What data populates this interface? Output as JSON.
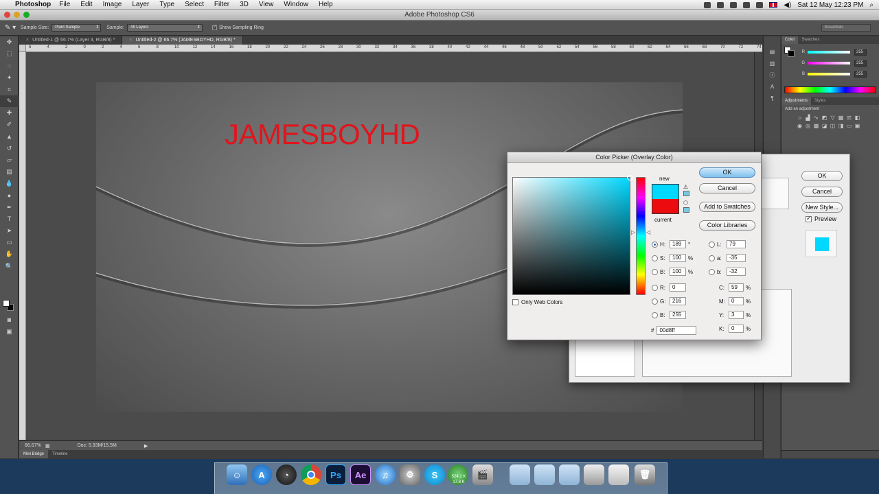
{
  "menubar": {
    "app_name": "Photoshop",
    "menus": [
      "File",
      "Edit",
      "Image",
      "Layer",
      "Type",
      "Select",
      "Filter",
      "3D",
      "View",
      "Window",
      "Help"
    ],
    "clock": "Sat 12 May  12:23 PM"
  },
  "window": {
    "title": "Adobe Photoshop CS6"
  },
  "options": {
    "sample_size_label": "Sample Size:",
    "sample_size_value": "Point Sample",
    "sample_label": "Sample:",
    "sample_value": "All Layers",
    "sampling_ring_label": "Show Sampling Ring",
    "workspace": "Essentials"
  },
  "doc_tabs": [
    {
      "label": "Untitled-1 @ 66.7% (Layer 3, RGB/8) *"
    },
    {
      "label": "Untitled-2 @ 66.7% (JAMESBOYHD, RGB/8) *"
    }
  ],
  "ruler_ticks": [
    "6",
    "4",
    "2",
    "0",
    "2",
    "4",
    "6",
    "8",
    "10",
    "12",
    "14",
    "16",
    "18",
    "20",
    "22",
    "24",
    "26",
    "28",
    "30",
    "32",
    "34",
    "36",
    "38",
    "40",
    "42",
    "44",
    "46",
    "48",
    "50",
    "52",
    "54",
    "56",
    "58",
    "60",
    "62",
    "64",
    "66",
    "68",
    "70",
    "72",
    "74"
  ],
  "canvas": {
    "text": "JAMESBOYHD",
    "text_color": "#e0151d"
  },
  "status": {
    "zoom": "66.67%",
    "doc_size": "Doc: 5.93M/15.5M"
  },
  "bottom_tabs": [
    "Mini Bridge",
    "Timeline"
  ],
  "color_panel": {
    "tabs": [
      "Color",
      "Swatches"
    ],
    "rows": [
      {
        "label": "R",
        "value": "255"
      },
      {
        "label": "G",
        "value": "255"
      },
      {
        "label": "B",
        "value": "255"
      }
    ]
  },
  "adjust_panel": {
    "tabs": [
      "Adjustments",
      "Styles"
    ],
    "header": "Add an adjustment"
  },
  "layer_style": {
    "ok": "OK",
    "cancel": "Cancel",
    "new_style": "New Style...",
    "preview": "Preview"
  },
  "picker": {
    "title": "Color Picker (Overlay Color)",
    "new_label": "new",
    "current_label": "current",
    "new_color": "#00d8ff",
    "current_color": "#ec0b0e",
    "buttons": {
      "ok": "OK",
      "cancel": "Cancel",
      "add_swatches": "Add to Swatches",
      "libraries": "Color Libraries"
    },
    "only_web": "Only Web Colors",
    "hsb": [
      {
        "label": "H:",
        "value": "189",
        "unit": "°"
      },
      {
        "label": "S:",
        "value": "100",
        "unit": "%"
      },
      {
        "label": "B:",
        "value": "100",
        "unit": "%"
      }
    ],
    "rgb": [
      {
        "label": "R:",
        "value": "0"
      },
      {
        "label": "G:",
        "value": "216"
      },
      {
        "label": "B:",
        "value": "255"
      }
    ],
    "lab": [
      {
        "label": "L:",
        "value": "79"
      },
      {
        "label": "a:",
        "value": "-35"
      },
      {
        "label": "b:",
        "value": "-32"
      }
    ],
    "cmyk": [
      {
        "label": "C:",
        "value": "59",
        "unit": "%"
      },
      {
        "label": "M:",
        "value": "0",
        "unit": "%"
      },
      {
        "label": "Y:",
        "value": "3",
        "unit": "%"
      },
      {
        "label": "K:",
        "value": "0",
        "unit": "%"
      }
    ],
    "hex_label": "#",
    "hex": "00d8ff"
  },
  "dock": {
    "apps": [
      "finder-icon",
      "app-store-icon",
      "dashboard-icon",
      "chrome-icon",
      "photoshop-icon",
      "after-effects-icon",
      "itunes-icon",
      "system-preferences-icon",
      "skype-icon",
      "network-meter-icon",
      "photo-booth-icon",
      "applications-folder-icon",
      "documents-folder-icon",
      "folder-icon",
      "stack-icon",
      "downloads-icon",
      "trash-icon"
    ],
    "ps_label": "Ps",
    "ae_label": "Ae",
    "net_up": "524.1 K",
    "net_down": "17.8 K"
  }
}
